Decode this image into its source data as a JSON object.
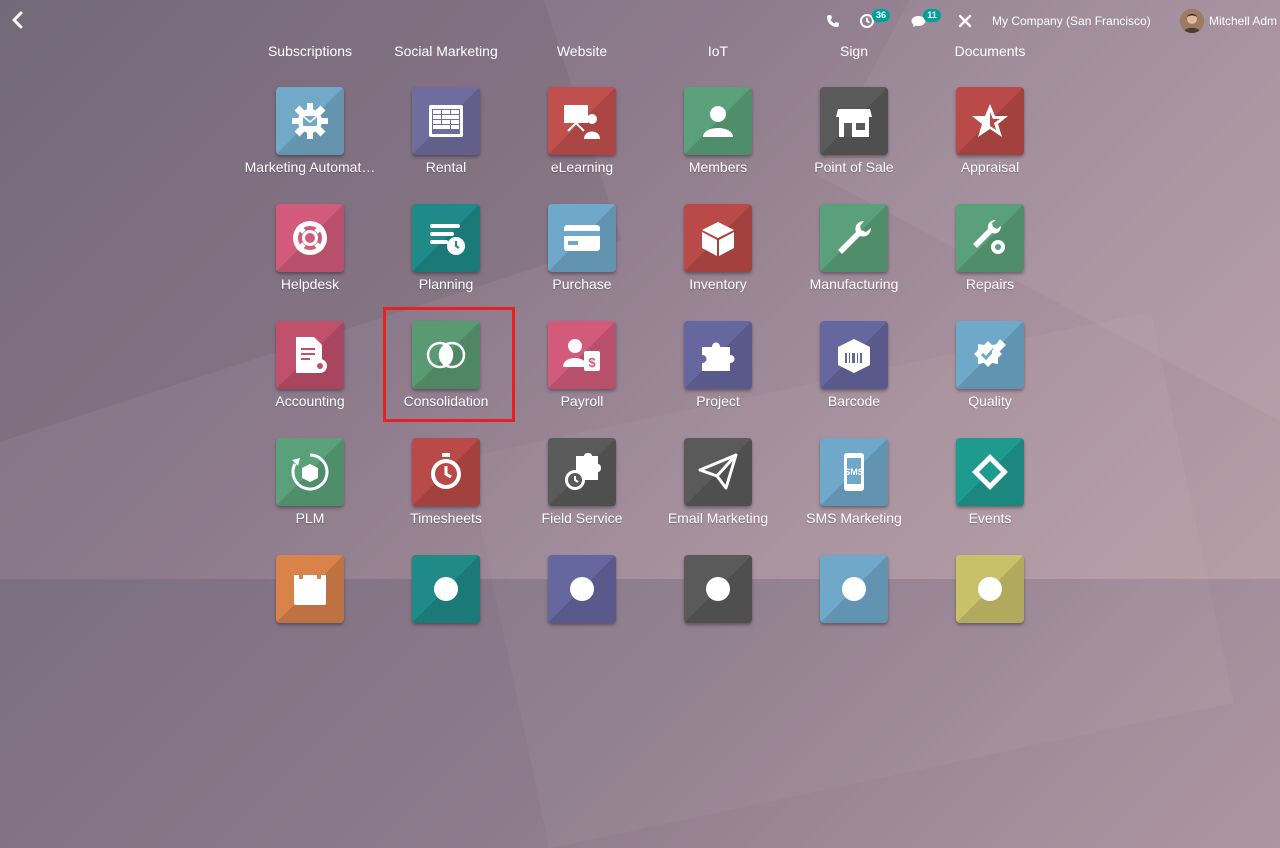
{
  "topbar": {
    "back_icon": "chevron-left-icon",
    "phone_icon": "phone-icon",
    "activity_icon": "clock-icon",
    "activity_count": "36",
    "messages_icon": "chat-icon",
    "messages_count": "11",
    "debug_icon": "close-icon",
    "company": "My Company (San Francisco)",
    "user": "Mitchell Adm",
    "badge_color": "#00a09d"
  },
  "top_row_labels": [
    "Subscriptions",
    "Social Marketing",
    "Website",
    "IoT",
    "Sign",
    "Documents"
  ],
  "apps": [
    {
      "label": "Marketing Automat…",
      "icon": "gear-envelope-icon",
      "color": "#72a9c6"
    },
    {
      "label": "Rental",
      "icon": "calendar-grid-icon",
      "color": "#6f6d9e"
    },
    {
      "label": "eLearning",
      "icon": "presentation-teacher-icon",
      "color": "#c0504d"
    },
    {
      "label": "Members",
      "icon": "user-icon",
      "color": "#5aa07a"
    },
    {
      "label": "Point of Sale",
      "icon": "shop-icon",
      "color": "#5a5a5a"
    },
    {
      "label": "Appraisal",
      "icon": "star-icon",
      "color": "#b94a48"
    },
    {
      "label": "Helpdesk",
      "icon": "lifebuoy-icon",
      "color": "#d25b7b"
    },
    {
      "label": "Planning",
      "icon": "planning-lines-icon",
      "color": "#1f8a87"
    },
    {
      "label": "Purchase",
      "icon": "credit-card-icon",
      "color": "#6fa8c9"
    },
    {
      "label": "Inventory",
      "icon": "box-icon",
      "color": "#b94a48"
    },
    {
      "label": "Manufacturing",
      "icon": "wrench-icon",
      "color": "#5aa07a"
    },
    {
      "label": "Repairs",
      "icon": "wrench-gear-icon",
      "color": "#5aa07a"
    },
    {
      "label": "Accounting",
      "icon": "document-gear-icon",
      "color": "#c0506c"
    },
    {
      "label": "Consolidation",
      "icon": "overlapping-circles-icon",
      "color": "#5a9a73"
    },
    {
      "label": "Payroll",
      "icon": "user-calendar-dollar-icon",
      "color": "#d25b7b"
    },
    {
      "label": "Project",
      "icon": "puzzle-icon",
      "color": "#65679e"
    },
    {
      "label": "Barcode",
      "icon": "barcode-box-icon",
      "color": "#65679e"
    },
    {
      "label": "Quality",
      "icon": "badge-check-pen-icon",
      "color": "#6fa8c9"
    },
    {
      "label": "PLM",
      "icon": "cycle-box-icon",
      "color": "#5aa07a"
    },
    {
      "label": "Timesheets",
      "icon": "stopwatch-icon",
      "color": "#b94a48"
    },
    {
      "label": "Field Service",
      "icon": "puzzle-clock-icon",
      "color": "#5a5a5a"
    },
    {
      "label": "Email Marketing",
      "icon": "paper-plane-icon",
      "color": "#5a5a5a"
    },
    {
      "label": "SMS Marketing",
      "icon": "phone-sms-icon",
      "color": "#6fa8c9"
    },
    {
      "label": "Events",
      "icon": "ticket-icon",
      "color": "#1f9a8f"
    },
    {
      "label": "",
      "icon": "calendar-icon",
      "color": "#d9824a"
    },
    {
      "label": "",
      "icon": "app-icon",
      "color": "#1f8a87"
    },
    {
      "label": "",
      "icon": "app-icon",
      "color": "#65679e"
    },
    {
      "label": "",
      "icon": "app-icon",
      "color": "#5a5a5a"
    },
    {
      "label": "",
      "icon": "app-icon",
      "color": "#6fa8c9"
    },
    {
      "label": "",
      "icon": "app-icon",
      "color": "#c9c06a"
    }
  ],
  "highlighted_app": "Consolidation"
}
